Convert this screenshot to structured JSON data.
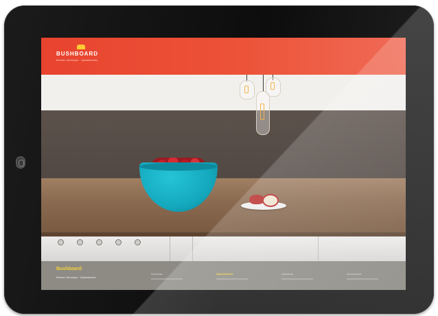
{
  "header": {
    "brand": "BUSHBOARD",
    "tagline": "kitchen worktops · splashbacks"
  },
  "footer": {
    "title": "Bushboard",
    "subtitle": "Kitchen Worktops · Splashbacks",
    "nav": [
      {
        "label": "Worktops",
        "active": false
      },
      {
        "label": "Splashbacks",
        "active": true
      },
      {
        "label": "Upstands",
        "active": false
      },
      {
        "label": "Accessories",
        "active": false
      }
    ]
  },
  "hob_dials": 5,
  "colors": {
    "header": "#e8432e",
    "accent": "#f3d23a",
    "bowl": "#14a8bd",
    "footer": "#8d8b84"
  }
}
